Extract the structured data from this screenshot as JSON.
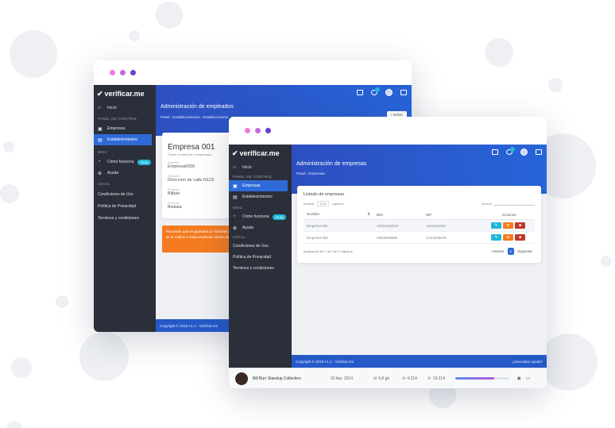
{
  "colors": {
    "dot1": "#f279d8",
    "dot2": "#c56ae0",
    "dot3": "#6a3fcf",
    "primary": "#2f6bd8",
    "sidebar": "#2b2f3a",
    "info": "#1fb8d6",
    "warning": "#f47b20",
    "danger": "#c0392b"
  },
  "brand": "verificar.me",
  "back_window": {
    "header_title": "Administración de empleados",
    "breadcrumb": [
      "Panel",
      "Establecimientos",
      "Establecimiento"
    ],
    "back_button": "Volver",
    "sidebar": {
      "inicio": "Inicio",
      "section_panel": "PANEL DE CONTROL",
      "empresas": "Empresas",
      "establecimientos": "Establecimientos",
      "section_misc": "MISC",
      "como_funciona": "Cómo funciona",
      "guia_badge": "Guía",
      "ayuda": "Ayuda",
      "section_legal": "LEGAL",
      "condiciones": "Condiciones de Uso",
      "politica": "Política de Privacidad",
      "terminos": "Terminos y condiciones"
    },
    "company": {
      "name": "Empresa 001",
      "subtitle": "Posee un total de 0 empleados",
      "fields": [
        {
          "label": "Empresa",
          "value": "Empresa0200"
        },
        {
          "label": "Dirección",
          "value": "Direccion de calle N123"
        },
        {
          "label": "Provincia",
          "value": "Bilbao"
        },
        {
          "label": "Provincia",
          "value": "Bizkaia"
        }
      ]
    },
    "alert": "Recuerde que se guardará un historial de cada acción que se le realice a cada empleado dentro del establecimiento",
    "footer": "Copyright © 2019 V1.1 - Verificar.me"
  },
  "front_window": {
    "header_title": "Administración de empresas",
    "breadcrumb": [
      "Panel",
      "Empresas"
    ],
    "sidebar": {
      "inicio": "Inicio",
      "section_panel": "PANEL DE CONTROL",
      "empresas": "Empresas",
      "establecimientos": "Establecimientos",
      "section_misc": "MISC",
      "como_funciona": "Cómo funciona",
      "guia_badge": "Guía",
      "ayuda": "Ayuda",
      "section_legal": "LEGAL",
      "condiciones": "Condiciones de Uso",
      "politica": "Política de Privacidad",
      "terminos": "Terminos y condiciones"
    },
    "list": {
      "title": "Listado de empresas",
      "show_label": "Mostrar",
      "show_value": "10",
      "records_label": "registros",
      "search_label": "Buscar:",
      "columns": [
        "Nombre",
        "DNI",
        "NIF",
        "Acciones"
      ],
      "rows": [
        {
          "nombre": "Empresa 001",
          "dni": "1231231234A",
          "nif": "1231231234"
        },
        {
          "nombre": "Empresa 002",
          "dni": "4564564568I",
          "nif": "C123345678"
        }
      ],
      "info": "Mostrando del 1 al 2 de 2 registros",
      "prev": "Anterior",
      "page": "1",
      "next": "Siguiente"
    },
    "footer_left": "Copyright © 2019 V1.1 - Verificar.me",
    "footer_right": "¿Necesitas ayuda?"
  },
  "player": {
    "title": "Bill Burr Standup Collection",
    "date": "02 Apr, 2014",
    "size": "9,8 gb",
    "downloads": "4,214",
    "uploads": "19,314",
    "progress": 0.72
  }
}
